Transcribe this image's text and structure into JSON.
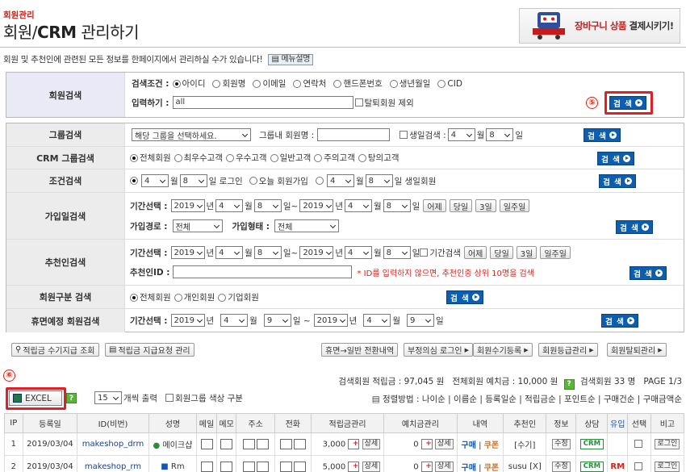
{
  "header": {
    "breadcrumb": "회원관리",
    "title_prefix": "회원/",
    "title_bold": "CRM",
    "title_suffix": " 관리하기",
    "banner_red": "장바구니 상품",
    "banner_rest": " 결제시키기!",
    "description": "회원 및 추천인에 관련된 모든 정보를 한페이지에서 관리하실 수가 있습니다!",
    "manual_btn": "메뉴설명"
  },
  "member_search": {
    "label": "회원검색",
    "condition_label": "검색조건 :",
    "conditions": [
      "아이디",
      "회원명",
      "이메일",
      "연락처",
      "핸드폰번호",
      "생년월일",
      "CID"
    ],
    "input_label": "입력하기 :",
    "input_value": "all",
    "exclude_label": "탈퇴회원 제외",
    "search_btn": "검 색",
    "marker": "⑤"
  },
  "rows": {
    "group": {
      "label": "그룹검색",
      "select": "해당 그룹을 선택하세요.",
      "name_label": "그룹내 회원명 :",
      "birth_label": "생일검색 :",
      "month": "4",
      "day": "8",
      "month_unit": "월",
      "day_unit": "일",
      "btn": "검 색"
    },
    "crm": {
      "label": "CRM 그룹검색",
      "options": [
        "전체회원",
        "최우수고객",
        "우수고객",
        "일반고객",
        "주의고객",
        "탕의고객"
      ],
      "btn": "검 색"
    },
    "condition": {
      "label": "조건검색",
      "m1": "4",
      "d1": "8",
      "login_text": "일 로그인",
      "today_join": "오늘 회원가입",
      "m2": "4",
      "d2": "8",
      "birth_text": "일 생일회원",
      "month_unit": "월",
      "btn": "검 색"
    },
    "join": {
      "label": "가입일검색",
      "period_label": "기간선택 :",
      "y1": "2019",
      "m1": "4",
      "d1": "8",
      "y2": "2019",
      "m2": "4",
      "d2": "8",
      "year_unit": "년",
      "month_unit": "월",
      "day_unit": "일",
      "tilde": "일~",
      "quick": [
        "어제",
        "당일",
        "3일",
        "일주일"
      ],
      "route_label": "가입경로 :",
      "route_value": "전체",
      "type_label": "가입형태 :",
      "type_value": "전체",
      "btn": "검 색"
    },
    "recommender": {
      "label": "추천인검색",
      "period_label": "기간선택 :",
      "y1": "2019",
      "m1": "4",
      "d1": "8",
      "y2": "2019",
      "m2": "4",
      "d2": "8",
      "year_unit": "년",
      "month_unit": "월",
      "day_unit": "일",
      "tilde": "일~",
      "period_check": "기간검색",
      "quick": [
        "어제",
        "당일",
        "3일",
        "일주일"
      ],
      "id_label": "추천인ID :",
      "notice": "* ID를 입력하지 않으면, 추천인중 상위 10명을 검색",
      "btn": "검 색"
    },
    "type": {
      "label": "회원구분 검색",
      "options": [
        "전체회원",
        "개인회원",
        "기업회원"
      ],
      "btn": "검 색"
    },
    "dormant": {
      "label": "휴면예정 회원검색",
      "period_label": "기간선택 :",
      "y1": "2019",
      "m1": "4",
      "d1": "9",
      "y2": "2019",
      "m2": "4",
      "d2": "9",
      "year_unit": "년",
      "month_unit": "월",
      "day_unit": "일",
      "sep": "일 ~",
      "btn": "검 색"
    }
  },
  "actions": {
    "left": [
      "적립금 수기지급 조회",
      "적립금 지급요청 관리"
    ],
    "right": [
      "휴면→일반 전환내역",
      "부정의심 로그인",
      "회원수기등록",
      "회원등급관리",
      "회원탈퇴관리"
    ]
  },
  "stats": {
    "line1_a": "검색회원 적립금 : 97,045 원",
    "line1_b": "전체회원 예치금 : 10,000 원",
    "line1_c": "검색회원 33 명",
    "line1_d": "PAGE 1/3",
    "sort_label": "정렬방법 :",
    "sorts": [
      "나이순",
      "이름순",
      "등록일순",
      "적립금순",
      "포인트순",
      "구매건순",
      "구매금액순"
    ]
  },
  "excel": {
    "marker": "⑥",
    "btn": "EXCEL",
    "count": "15",
    "count_label": "개씩 출력",
    "color_label": "회원그룹 색상 구분"
  },
  "table": {
    "headers": [
      "IP",
      "등록일",
      "ID(비번)",
      "성명",
      "메일",
      "메모",
      "주소",
      "전화",
      "적립금관리",
      "예치금관리",
      "내역",
      "추천인",
      "정보",
      "상담",
      "유입",
      "선택",
      "비고"
    ],
    "rows": [
      {
        "ip": "1",
        "date": "2019/03/04",
        "id": "makeshop_drm",
        "name": "메이크샵",
        "points": "3,000",
        "deposit": "0",
        "buy": "구매",
        "coupon": "쿠폰",
        "rec": "[수기]",
        "info": "수정",
        "crm": "CRM",
        "inflow": "",
        "login": "로그인"
      },
      {
        "ip": "2",
        "date": "2019/03/04",
        "id": "makeshop_rm",
        "name": "Rm",
        "points": "5,000",
        "deposit": "0",
        "buy": "구매",
        "coupon": "쿠폰",
        "rec": "susu [X]",
        "info": "수정",
        "crm": "CRM",
        "inflow": "RM",
        "login": "로그인"
      }
    ],
    "detail_btn": "상세",
    "plus": "+",
    "minus": "-",
    "sep": "|"
  },
  "colors": {
    "accent_blue": "#0e5eb0",
    "marker_red": "#e31e24",
    "crumb_red": "#c0261d"
  }
}
